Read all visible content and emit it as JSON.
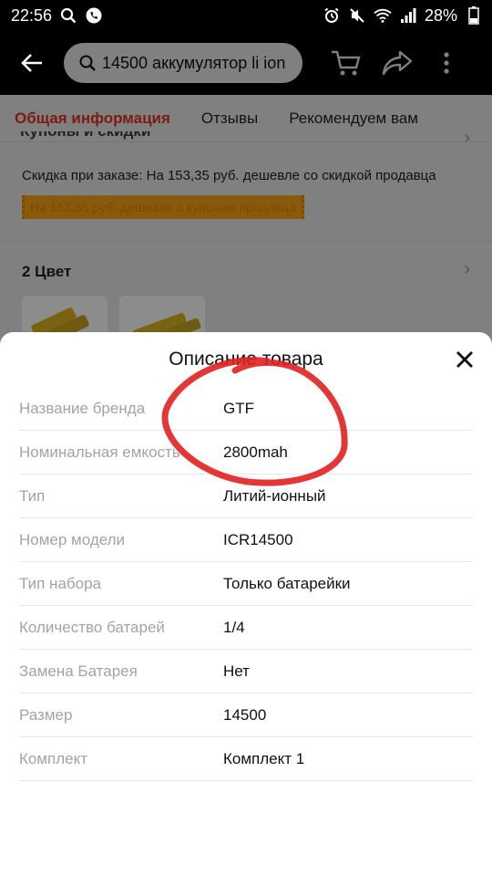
{
  "status_bar": {
    "time": "22:56",
    "battery": "28%"
  },
  "search": {
    "query": "14500 аккумулятор li ion"
  },
  "tabs": [
    "Общая информация",
    "Отзывы",
    "Рекомендуем вам"
  ],
  "page": {
    "section_title": "Купоны и скидки",
    "discount_text": "Скидка при заказе: На 153,35 руб. дешевле со скидкой продавца",
    "coupon_text": "На 153,35 руб. дешевле с купоном продавца",
    "color_title": "2 Цвет"
  },
  "sheet": {
    "title": "Описание товара",
    "specs": [
      {
        "key": "Название бренда",
        "value": "GTF"
      },
      {
        "key": "Номинальная емкость",
        "value": "2800mah"
      },
      {
        "key": "Тип",
        "value": "Литий-ионный"
      },
      {
        "key": "Номер модели",
        "value": "ICR14500"
      },
      {
        "key": "Тип набора",
        "value": "Только батарейки"
      },
      {
        "key": "Количество батарей",
        "value": "1/4"
      },
      {
        "key": "Замена Батарея",
        "value": "Нет"
      },
      {
        "key": "Размер",
        "value": "14500"
      },
      {
        "key": "Комплект",
        "value": "Комплект 1"
      }
    ]
  },
  "colors": {
    "accent": "#d0402c",
    "coupon": "#f5a623",
    "annotation": "#e02020"
  }
}
